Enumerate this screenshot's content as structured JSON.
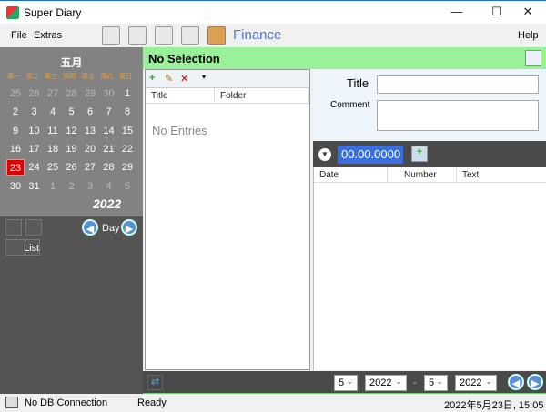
{
  "window": {
    "title": "Super Diary",
    "minimize": "—",
    "maximize": "☐",
    "close": "✕"
  },
  "menu": {
    "file": "File",
    "extras": "Extras",
    "help": "Help",
    "module": "Finance"
  },
  "calendar": {
    "month": "五月",
    "year": "2022",
    "weekdays": [
      "周一",
      "周二",
      "周三",
      "周四",
      "周五",
      "周六",
      "周日"
    ],
    "days": [
      [
        "25",
        "26",
        "27",
        "28",
        "29",
        "30",
        "1"
      ],
      [
        "2",
        "3",
        "4",
        "5",
        "6",
        "7",
        "8"
      ],
      [
        "9",
        "10",
        "11",
        "12",
        "13",
        "14",
        "15"
      ],
      [
        "16",
        "17",
        "18",
        "19",
        "20",
        "21",
        "22"
      ],
      [
        "23",
        "24",
        "25",
        "26",
        "27",
        "28",
        "29"
      ],
      [
        "30",
        "31",
        "1",
        "2",
        "3",
        "4",
        "5"
      ]
    ],
    "today": "23",
    "accent": "#e00000"
  },
  "left_controls": {
    "day_label": "Day",
    "list_label": "List"
  },
  "header": {
    "selection": "No Selection"
  },
  "entries": {
    "columns": [
      "Title",
      "Folder"
    ],
    "empty": "No Entries"
  },
  "form": {
    "title_label": "Title",
    "comment_label": "Comment",
    "title_value": "",
    "comment_value": ""
  },
  "finance": {
    "date_value": "00.00.0000",
    "columns": [
      "Date",
      "Number",
      "Text"
    ]
  },
  "range": {
    "from_month": "5",
    "from_year": "2022",
    "sep": "-",
    "to_month": "5",
    "to_year": "2022"
  },
  "status": {
    "db": "No DB Connection",
    "state": "Ready",
    "datetime": "2022年5月23日, 15:05"
  }
}
